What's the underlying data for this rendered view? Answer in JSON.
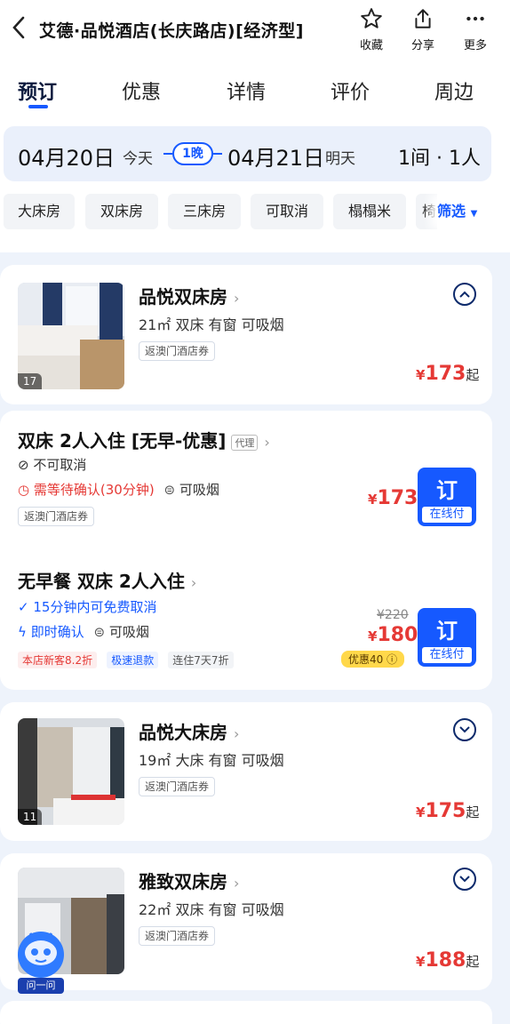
{
  "header": {
    "title": "艾德·品悦酒店(长庆路店)[经济型]",
    "actions": [
      {
        "label": "收藏",
        "icon": "star-icon"
      },
      {
        "label": "分享",
        "icon": "share-icon"
      },
      {
        "label": "更多",
        "icon": "more-icon"
      }
    ]
  },
  "tabs": [
    "预订",
    "优惠",
    "详情",
    "评价",
    "周边"
  ],
  "date_bar": {
    "checkin_date": "04月20日",
    "checkin_day": "今天",
    "nights": "1晚",
    "checkout_date": "04月21日",
    "checkout_day": "明天",
    "guests": "1间 · 1人"
  },
  "filters": [
    "大床房",
    "双床房",
    "三床房",
    "可取消",
    "榻榻米",
    "椅"
  ],
  "filter_button": "筛选",
  "rooms": [
    {
      "name": "品悦双床房",
      "desc": "21㎡ 双床 有窗 可吸烟",
      "voucher": "返澳门酒店券",
      "photo_count": "17",
      "price_symbol": "¥",
      "price": "173",
      "price_suffix": "起"
    },
    {
      "name": "品悦大床房",
      "desc": "19㎡ 大床 有窗 可吸烟",
      "voucher": "返澳门酒店券",
      "photo_count": "11",
      "price_symbol": "¥",
      "price": "175",
      "price_suffix": "起"
    },
    {
      "name": "雅致双床房",
      "desc": "22㎡ 双床 有窗 可吸烟",
      "voucher": "返澳门酒店券",
      "photo_count": "",
      "price_symbol": "¥",
      "price": "188",
      "price_suffix": "起"
    }
  ],
  "rate_plans": [
    {
      "name": "双床 2人入住 [无早-优惠]",
      "tag": "代理",
      "cancel": "不可取消",
      "confirm": "需等待确认(30分钟)",
      "smoke": "可吸烟",
      "voucher": "返澳门酒店券",
      "price_symbol": "¥",
      "price": "173",
      "book_label": "订",
      "book_sub": "在线付"
    },
    {
      "name": "无早餐 双床 2人入住",
      "cancel": "15分钟内可免费取消",
      "confirm": "即时确认",
      "smoke": "可吸烟",
      "promo_tags": [
        "本店新客8.2折",
        "极速退款",
        "连住7天7折"
      ],
      "original_price": "¥220",
      "price_symbol": "¥",
      "price": "180",
      "discount_badge": "优惠40",
      "book_label": "订",
      "book_sub": "在线付"
    }
  ],
  "assistant_label": "问一问",
  "colors": {
    "accent": "#1659ff",
    "price": "#e53935",
    "background": "#eef3fb"
  }
}
